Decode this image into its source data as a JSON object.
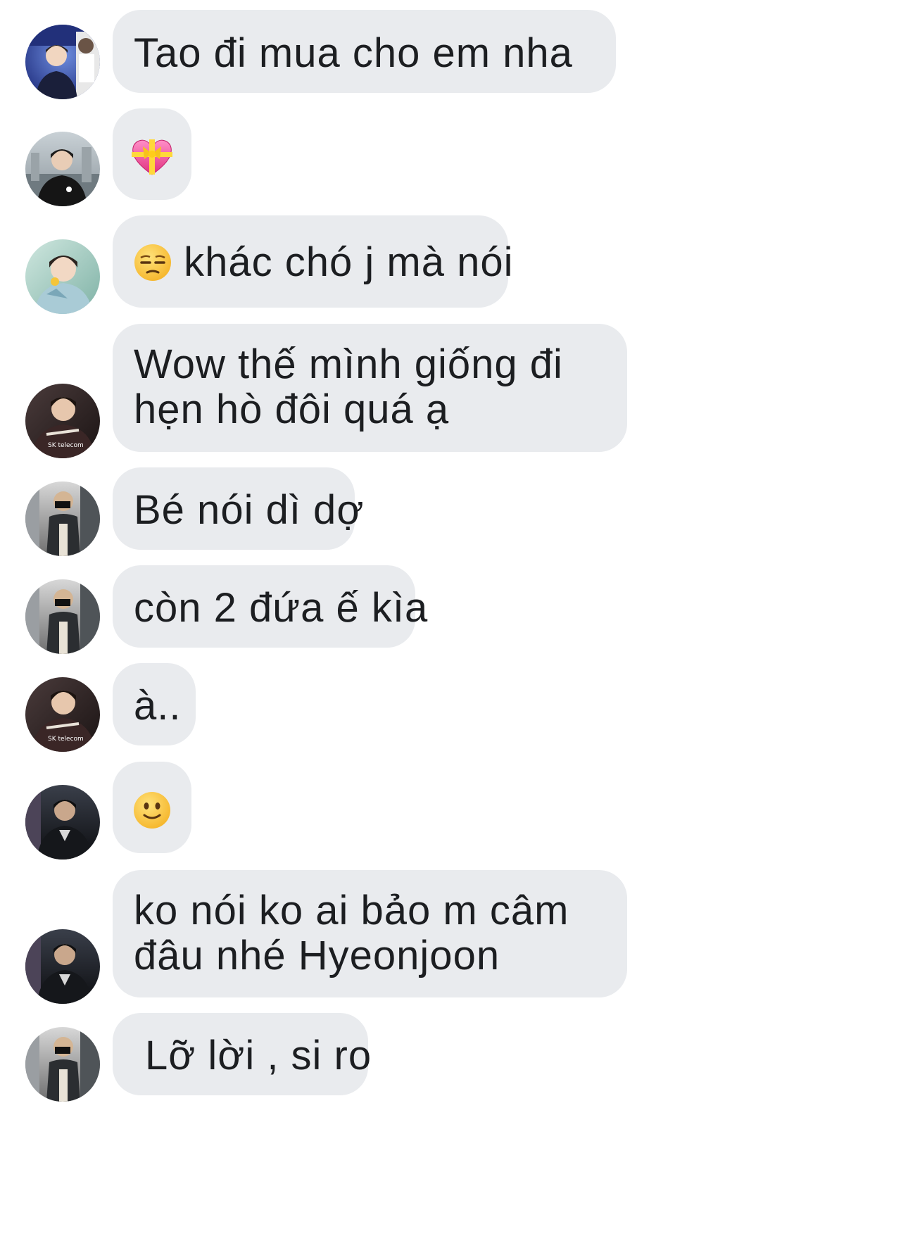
{
  "chat": {
    "messages": [
      {
        "id": "m1",
        "text": "Tao đi mua cho em nha",
        "avatar": "avatar-1"
      },
      {
        "id": "m2",
        "emoji": "heart-with-ribbon-icon",
        "avatar": "avatar-2"
      },
      {
        "id": "m3",
        "emoji": "unamused-face-icon",
        "text": "khác chó j mà nói",
        "avatar": "avatar-3"
      },
      {
        "id": "m4",
        "lines": [
          "Wow thế mình giống đi",
          "hẹn hò đôi quá ạ"
        ],
        "avatar": "avatar-4"
      },
      {
        "id": "m5",
        "text": "Bé nói dì dợ",
        "avatar": "avatar-5"
      },
      {
        "id": "m6",
        "text": "còn 2 đứa ế kìa",
        "avatar": "avatar-5"
      },
      {
        "id": "m7",
        "text": "à..",
        "avatar": "avatar-4"
      },
      {
        "id": "m8",
        "emoji": "slightly-smiling-face-icon",
        "avatar": "avatar-6"
      },
      {
        "id": "m9",
        "lines": [
          "ko nói ko ai bảo m câm",
          "đâu nhé Hyeonjoon"
        ],
        "avatar": "avatar-6"
      },
      {
        "id": "m10",
        "text": "Lỡ lời , si ro",
        "avatar": "avatar-5"
      }
    ]
  },
  "colors": {
    "bubble_background": "#e9ebee",
    "text": "#1c1e21",
    "page_background": "#ffffff"
  }
}
